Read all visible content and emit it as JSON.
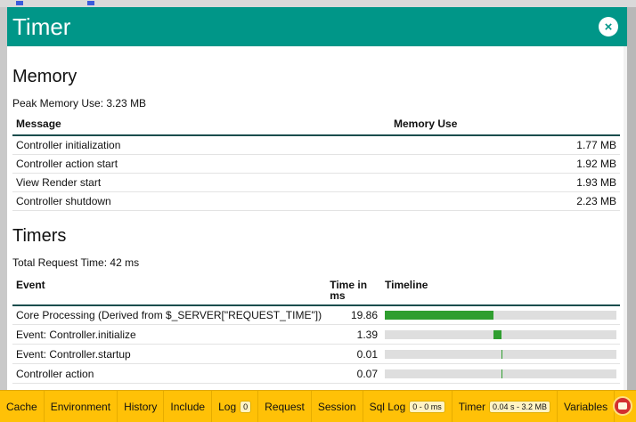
{
  "panel": {
    "title": "Timer",
    "close_glyph": "×"
  },
  "memory": {
    "heading": "Memory",
    "peak_label": "Peak Memory Use:",
    "peak_value": "3.23 MB",
    "columns": {
      "message": "Message",
      "memory_use": "Memory Use"
    },
    "rows": [
      {
        "message": "Controller initialization",
        "value": "1.77 MB"
      },
      {
        "message": "Controller action start",
        "value": "1.92 MB"
      },
      {
        "message": "View Render start",
        "value": "1.93 MB"
      },
      {
        "message": "Controller shutdown",
        "value": "2.23 MB"
      }
    ]
  },
  "timers": {
    "heading": "Timers",
    "total_label": "Total Request Time:",
    "total_value": "42 ms",
    "columns": {
      "event": "Event",
      "time": "Time in ms",
      "timeline": "Timeline"
    },
    "rows": [
      {
        "event": "Core Processing (Derived from $_SERVER[\"REQUEST_TIME\"])",
        "time": "19.86",
        "start_fraction": 0.0,
        "duration_fraction": 0.47
      },
      {
        "event": "Event: Controller.initialize",
        "time": "1.39",
        "start_fraction": 0.47,
        "duration_fraction": 0.033
      },
      {
        "event": "Event: Controller.startup",
        "time": "0.01",
        "start_fraction": 0.503,
        "duration_fraction": 0.004
      },
      {
        "event": "Controller action",
        "time": "0.07",
        "start_fraction": 0.503,
        "duration_fraction": 0.004
      }
    ]
  },
  "toolbar": {
    "items": [
      {
        "label": "Cache",
        "badge": ""
      },
      {
        "label": "Environment",
        "badge": ""
      },
      {
        "label": "History",
        "badge": ""
      },
      {
        "label": "Include",
        "badge": ""
      },
      {
        "label": "Log",
        "badge": "0"
      },
      {
        "label": "Request",
        "badge": ""
      },
      {
        "label": "Session",
        "badge": ""
      },
      {
        "label": "Sql Log",
        "badge": "0 - 0 ms"
      },
      {
        "label": "Timer",
        "badge": "0.04 s - 3.2 MB"
      },
      {
        "label": "Variables",
        "badge": ""
      }
    ],
    "logo_icon": "cakephp-logo-icon"
  },
  "colors": {
    "header": "#009688",
    "toolbar": "#ffc107",
    "timeline_fill": "#2f9e2f"
  }
}
